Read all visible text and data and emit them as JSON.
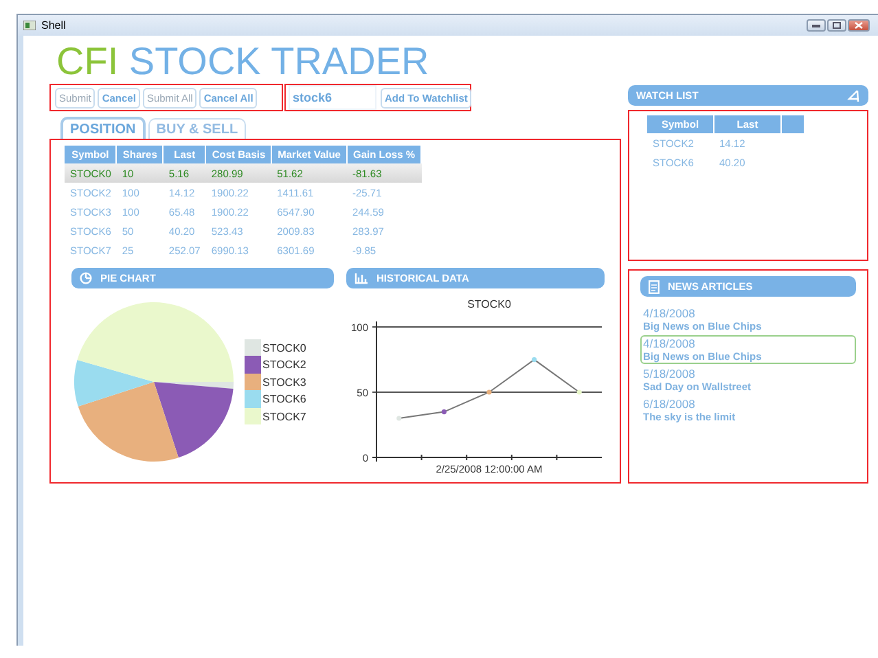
{
  "window": {
    "title": "Shell"
  },
  "app_title": {
    "brand": "CFI",
    "rest": "STOCK TRADER"
  },
  "order_buttons": [
    {
      "label": "Submit",
      "disabled": true
    },
    {
      "label": "Cancel",
      "disabled": false
    },
    {
      "label": "Submit All",
      "disabled": true
    },
    {
      "label": "Cancel All",
      "disabled": false
    }
  ],
  "watch_input": {
    "value": "stock6"
  },
  "watch_button": {
    "label": "Add To Watchlist"
  },
  "tabs": [
    {
      "label": "POSITION",
      "selected": true
    },
    {
      "label": "BUY & SELL",
      "selected": false
    }
  ],
  "positions": {
    "columns": [
      "Symbol",
      "Shares",
      "Last",
      "Cost Basis",
      "Market Value",
      "Gain Loss %"
    ],
    "rows": [
      {
        "cells": [
          "STOCK0",
          "10",
          "5.16",
          "280.99",
          "51.62",
          "-81.63"
        ],
        "selected": true
      },
      {
        "cells": [
          "STOCK2",
          "100",
          "14.12",
          "1900.22",
          "1411.61",
          "-25.71"
        ],
        "selected": false
      },
      {
        "cells": [
          "STOCK3",
          "100",
          "65.48",
          "1900.22",
          "6547.90",
          "244.59"
        ],
        "selected": false
      },
      {
        "cells": [
          "STOCK6",
          "50",
          "40.20",
          "523.43",
          "2009.83",
          "283.97"
        ],
        "selected": false
      },
      {
        "cells": [
          "STOCK7",
          "25",
          "252.07",
          "6990.13",
          "6301.69",
          "-9.85"
        ],
        "selected": false
      }
    ]
  },
  "pie_panel": {
    "title": "PIE CHART",
    "legend": [
      {
        "label": "STOCK0",
        "color": "#dfe6e2"
      },
      {
        "label": "STOCK2",
        "color": "#8b5bb5"
      },
      {
        "label": "STOCK3",
        "color": "#e8b07e"
      },
      {
        "label": "STOCK6",
        "color": "#9adcef"
      },
      {
        "label": "STOCK7",
        "color": "#eaf8cc"
      }
    ]
  },
  "history_panel": {
    "title": "HISTORICAL DATA",
    "chart_data": {
      "type": "line",
      "title": "STOCK0",
      "xlabel": "2/25/2008 12:00:00 AM",
      "ylim": [
        0,
        100
      ],
      "yticks": [
        0,
        50,
        100
      ],
      "series": [
        {
          "color": "#777777",
          "marker": true,
          "values": [
            30,
            35,
            50,
            75,
            50
          ]
        }
      ]
    }
  },
  "watch_list": {
    "title": "WATCH LIST",
    "columns": [
      "Symbol",
      "Last"
    ],
    "rows": [
      [
        "STOCK2",
        "14.12"
      ],
      [
        "STOCK6",
        "40.20"
      ]
    ]
  },
  "news": {
    "title": "NEWS ARTICLES",
    "items": [
      {
        "date": "4/18/2008",
        "headline": "Big News on Blue Chips",
        "selected": false
      },
      {
        "date": "4/18/2008",
        "headline": "Big News on Blue Chips",
        "selected": true
      },
      {
        "date": "5/18/2008",
        "headline": "Sad Day on Wallstreet",
        "selected": false
      },
      {
        "date": "6/18/2008",
        "headline": "The sky is the limit",
        "selected": false
      }
    ]
  }
}
